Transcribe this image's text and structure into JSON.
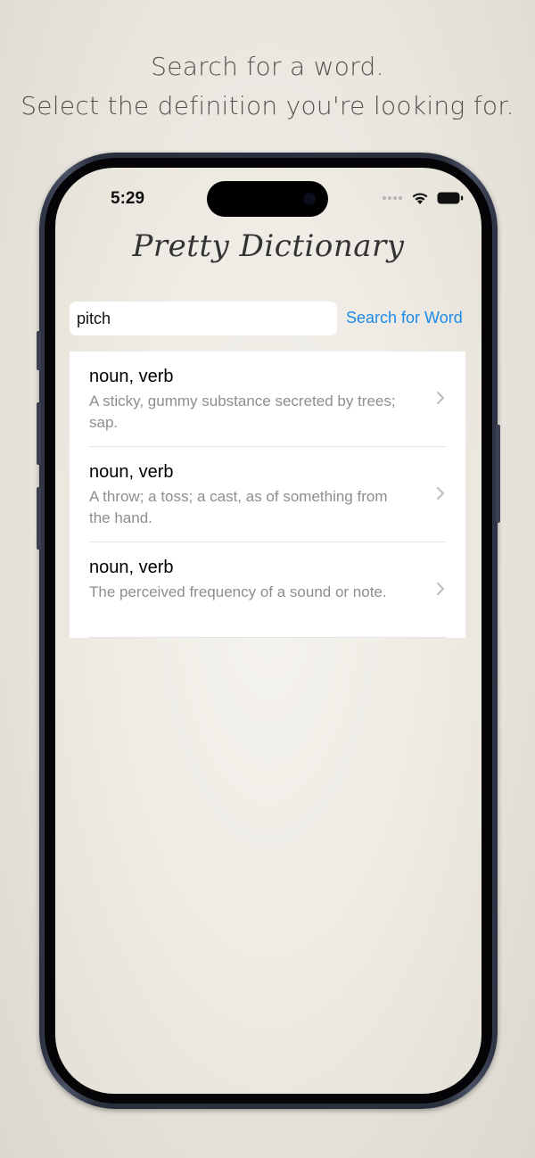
{
  "caption": {
    "line1": "Search for a word.",
    "line2": "Select the definition you're looking for."
  },
  "status_bar": {
    "time": "5:29",
    "icons": [
      "signal-dots-icon",
      "wifi-icon",
      "battery-icon"
    ]
  },
  "app": {
    "title": "Pretty Dictionary"
  },
  "search": {
    "value": "pitch",
    "button_label": "Search for Word"
  },
  "results": [
    {
      "part_of_speech": "noun, verb",
      "definition": "A sticky, gummy substance secreted by trees; sap."
    },
    {
      "part_of_speech": "noun, verb",
      "definition": "A throw; a toss; a cast, as of something from the hand."
    },
    {
      "part_of_speech": "noun, verb",
      "definition": "The perceived frequency of a sound or note."
    }
  ],
  "colors": {
    "accent": "#1e8ae8",
    "secondary_text": "#8e8e8e",
    "phone_frame": "#2a2f3d"
  }
}
